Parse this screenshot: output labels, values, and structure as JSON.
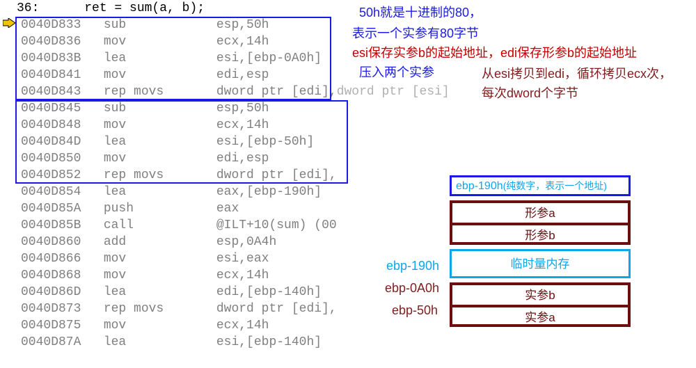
{
  "source_line": "36:      ret = sum(a, b);",
  "asm": [
    {
      "addr": "0040D833",
      "op": "sub",
      "args": "esp,50h"
    },
    {
      "addr": "0040D836",
      "op": "mov",
      "args": "ecx,14h"
    },
    {
      "addr": "0040D83B",
      "op": "lea",
      "args": "esi,[ebp-0A0h]"
    },
    {
      "addr": "0040D841",
      "op": "mov",
      "args": "edi,esp"
    },
    {
      "addr": "0040D843",
      "op": "rep movs",
      "args": "dword ptr [edi],",
      "tail": "dword ptr [esi]"
    },
    {
      "addr": "0040D845",
      "op": "sub",
      "args": "esp,50h"
    },
    {
      "addr": "0040D848",
      "op": "mov",
      "args": "ecx,14h"
    },
    {
      "addr": "0040D84D",
      "op": "lea",
      "args": "esi,[ebp-50h]"
    },
    {
      "addr": "0040D850",
      "op": "mov",
      "args": "edi,esp"
    },
    {
      "addr": "0040D852",
      "op": "rep movs",
      "args": "dword ptr [edi],"
    },
    {
      "addr": "0040D854",
      "op": "lea",
      "args": "eax,[ebp-190h]"
    },
    {
      "addr": "0040D85A",
      "op": "push",
      "args": "eax"
    },
    {
      "addr": "0040D85B",
      "op": "call",
      "args": "@ILT+10(sum) (00"
    },
    {
      "addr": "0040D860",
      "op": "add",
      "args": "esp,0A4h"
    },
    {
      "addr": "0040D866",
      "op": "mov",
      "args": "esi,eax"
    },
    {
      "addr": "0040D868",
      "op": "mov",
      "args": "ecx,14h"
    },
    {
      "addr": "0040D86D",
      "op": "lea",
      "args": "edi,[ebp-140h]"
    },
    {
      "addr": "0040D873",
      "op": "rep movs",
      "args": "dword ptr [edi],"
    },
    {
      "addr": "0040D875",
      "op": "mov",
      "args": "ecx,14h"
    },
    {
      "addr": "0040D87A",
      "op": "lea",
      "args": "esi,[ebp-140h]"
    }
  ],
  "annotations": {
    "a1": "50h就是十进制的80，",
    "a2": "表示一个实参有80字节",
    "a3": "esi保存实参b的起始地址，edi保存形参b的起始地址",
    "a4": "压入两个实参",
    "a5": "从esi拷贝到edi，循环拷贝ecx次，",
    "a6": "每次dword个字节"
  },
  "stack": {
    "header_main": "ebp-190h",
    "header_sub": "(纯数字，表示一个地址)",
    "cells": [
      "形参a",
      "形参b",
      "临时量内存",
      "实参b",
      "实参a"
    ],
    "labels": {
      "l1": "ebp-190h",
      "l2": "ebp-0A0h",
      "l3": "ebp-50h"
    }
  }
}
